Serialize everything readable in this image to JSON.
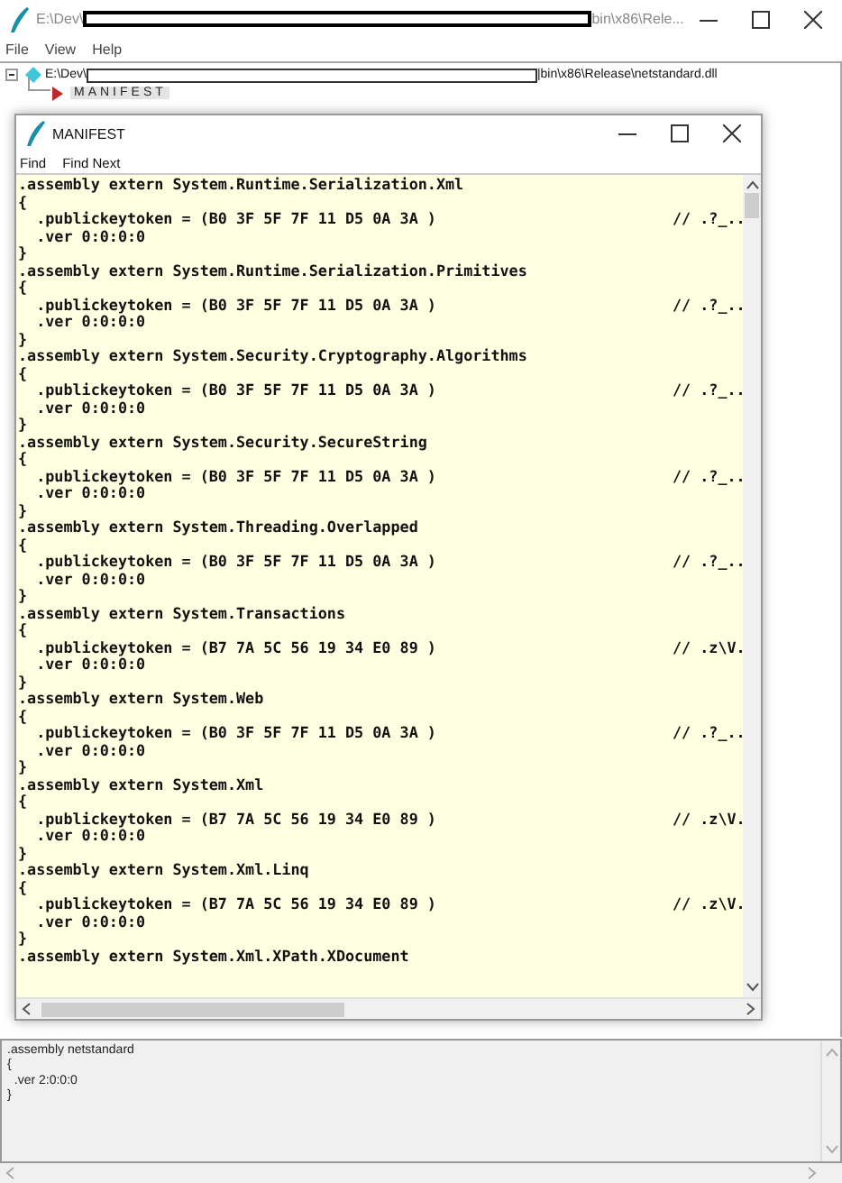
{
  "window": {
    "title_start": "E:\\Dev\\",
    "redacted": true,
    "title_end": "bin\\x86\\Rele..."
  },
  "menu": [
    {
      "label": "File"
    },
    {
      "label": "View"
    },
    {
      "label": "Help"
    }
  ],
  "tree": [
    {
      "label_start": "E:\\Dev\\",
      "redacted": true,
      "label_end": "|bin\\x86\\Release\\netstandard.dll",
      "expanded": true,
      "children": [
        {
          "label": "MANIFEST",
          "selected": true
        }
      ]
    }
  ],
  "manifest_window": {
    "title": "MANIFEST",
    "menu": [
      {
        "label": "Find"
      },
      {
        "label": "Find Next"
      }
    ],
    "lines": [
      {
        "text": ".assembly extern System.Runtime.Serialization.Xml"
      },
      {
        "text": "{"
      },
      {
        "text": "  .publickeytoken = (B0 3F 5F 7F 11 D5 0A 3A )",
        "comment": "// .?_.."
      },
      {
        "text": "  .ver 0:0:0:0"
      },
      {
        "text": "}"
      },
      {
        "text": ".assembly extern System.Runtime.Serialization.Primitives"
      },
      {
        "text": "{"
      },
      {
        "text": "  .publickeytoken = (B0 3F 5F 7F 11 D5 0A 3A )",
        "comment": "// .?_.."
      },
      {
        "text": "  .ver 0:0:0:0"
      },
      {
        "text": "}"
      },
      {
        "text": ".assembly extern System.Security.Cryptography.Algorithms"
      },
      {
        "text": "{"
      },
      {
        "text": "  .publickeytoken = (B0 3F 5F 7F 11 D5 0A 3A )",
        "comment": "// .?_.."
      },
      {
        "text": "  .ver 0:0:0:0"
      },
      {
        "text": "}"
      },
      {
        "text": ".assembly extern System.Security.SecureString"
      },
      {
        "text": "{"
      },
      {
        "text": "  .publickeytoken = (B0 3F 5F 7F 11 D5 0A 3A )",
        "comment": "// .?_.."
      },
      {
        "text": "  .ver 0:0:0:0"
      },
      {
        "text": "}"
      },
      {
        "text": ".assembly extern System.Threading.Overlapped"
      },
      {
        "text": "{"
      },
      {
        "text": "  .publickeytoken = (B0 3F 5F 7F 11 D5 0A 3A )",
        "comment": "// .?_.."
      },
      {
        "text": "  .ver 0:0:0:0"
      },
      {
        "text": "}"
      },
      {
        "text": ".assembly extern System.Transactions"
      },
      {
        "text": "{"
      },
      {
        "text": "  .publickeytoken = (B7 7A 5C 56 19 34 E0 89 )",
        "comment": "// .z\\V."
      },
      {
        "text": "  .ver 0:0:0:0"
      },
      {
        "text": "}"
      },
      {
        "text": ".assembly extern System.Web"
      },
      {
        "text": "{"
      },
      {
        "text": "  .publickeytoken = (B0 3F 5F 7F 11 D5 0A 3A )",
        "comment": "// .?_.."
      },
      {
        "text": "  .ver 0:0:0:0"
      },
      {
        "text": "}"
      },
      {
        "text": ".assembly extern System.Xml"
      },
      {
        "text": "{"
      },
      {
        "text": "  .publickeytoken = (B7 7A 5C 56 19 34 E0 89 )",
        "comment": "// .z\\V."
      },
      {
        "text": "  .ver 0:0:0:0"
      },
      {
        "text": "}"
      },
      {
        "text": ".assembly extern System.Xml.Linq"
      },
      {
        "text": "{"
      },
      {
        "text": "  .publickeytoken = (B7 7A 5C 56 19 34 E0 89 )",
        "comment": "// .z\\V."
      },
      {
        "text": "  .ver 0:0:0:0"
      },
      {
        "text": "}"
      },
      {
        "text": ".assembly extern System.Xml.XPath.XDocument"
      }
    ]
  },
  "details": {
    "lines": [
      {
        "text": ".assembly netstandard"
      },
      {
        "text": "{"
      },
      {
        "text": "  .ver 2:0:0:0"
      },
      {
        "text": "}"
      }
    ]
  }
}
